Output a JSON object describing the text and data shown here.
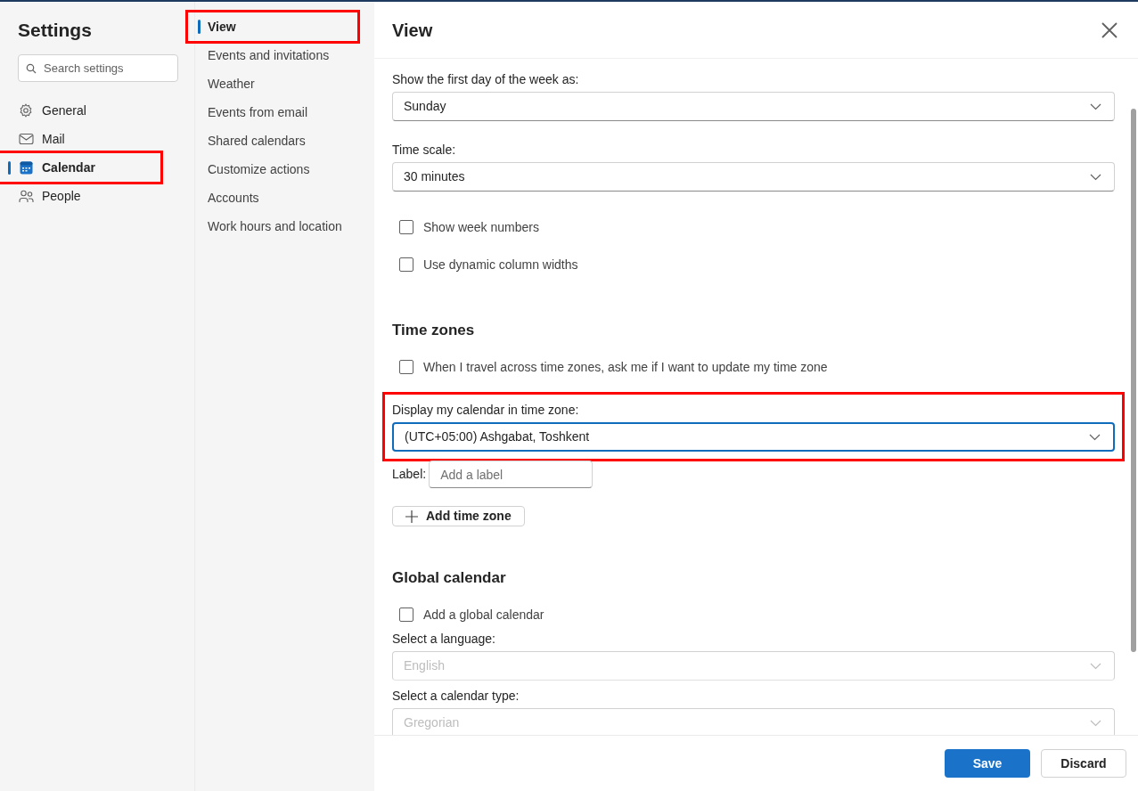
{
  "settings_title": "Settings",
  "search": {
    "placeholder": "Search settings"
  },
  "nav": [
    {
      "label": "General",
      "selected": false,
      "highlighted": false
    },
    {
      "label": "Mail",
      "selected": false,
      "highlighted": false
    },
    {
      "label": "Calendar",
      "selected": true,
      "highlighted": true
    },
    {
      "label": "People",
      "selected": false,
      "highlighted": false
    }
  ],
  "subnav": [
    {
      "label": "View",
      "selected": true,
      "highlighted": true
    },
    {
      "label": "Events and invitations",
      "selected": false,
      "highlighted": false
    },
    {
      "label": "Weather",
      "selected": false,
      "highlighted": false
    },
    {
      "label": "Events from email",
      "selected": false,
      "highlighted": false
    },
    {
      "label": "Shared calendars",
      "selected": false,
      "highlighted": false
    },
    {
      "label": "Customize actions",
      "selected": false,
      "highlighted": false
    },
    {
      "label": "Accounts",
      "selected": false,
      "highlighted": false
    },
    {
      "label": "Work hours and location",
      "selected": false,
      "highlighted": false
    }
  ],
  "panel": {
    "title": "View",
    "items": [
      {
        "kind": "dropdown",
        "label": "Show the first day of the week as:",
        "value": "Sunday",
        "disabled": false,
        "focused": false,
        "highlighted": false
      },
      {
        "kind": "dropdown",
        "label": "Time scale:",
        "value": "30 minutes",
        "disabled": false,
        "focused": false,
        "highlighted": false
      },
      {
        "kind": "checkbox",
        "label": "Show week numbers",
        "checked": false
      },
      {
        "kind": "checkbox",
        "label": "Use dynamic column widths",
        "checked": false
      },
      {
        "kind": "divider"
      },
      {
        "kind": "heading",
        "label": "Time zones"
      },
      {
        "kind": "checkbox",
        "label": "When I travel across time zones, ask me if I want to update my time zone",
        "checked": false
      },
      {
        "kind": "dropdown",
        "label": "Display my calendar in time zone:",
        "value": "(UTC+05:00) Ashgabat, Toshkent",
        "disabled": false,
        "focused": true,
        "highlighted": true
      },
      {
        "kind": "text_field",
        "label": "Label:",
        "placeholder": "Add a label"
      },
      {
        "kind": "add_button",
        "label": "Add time zone"
      },
      {
        "kind": "divider"
      },
      {
        "kind": "heading",
        "label": "Global calendar"
      },
      {
        "kind": "checkbox",
        "label": "Add a global calendar",
        "checked": false
      },
      {
        "kind": "dropdown",
        "label": "Select a language:",
        "value": "English",
        "disabled": true,
        "focused": false,
        "highlighted": false
      },
      {
        "kind": "dropdown",
        "label": "Select a calendar type:",
        "value": "Gregorian",
        "disabled": true,
        "focused": false,
        "highlighted": false
      }
    ]
  },
  "footer_buttons": [
    {
      "label": "Save",
      "primary": true
    },
    {
      "label": "Discard",
      "primary": false
    }
  ]
}
